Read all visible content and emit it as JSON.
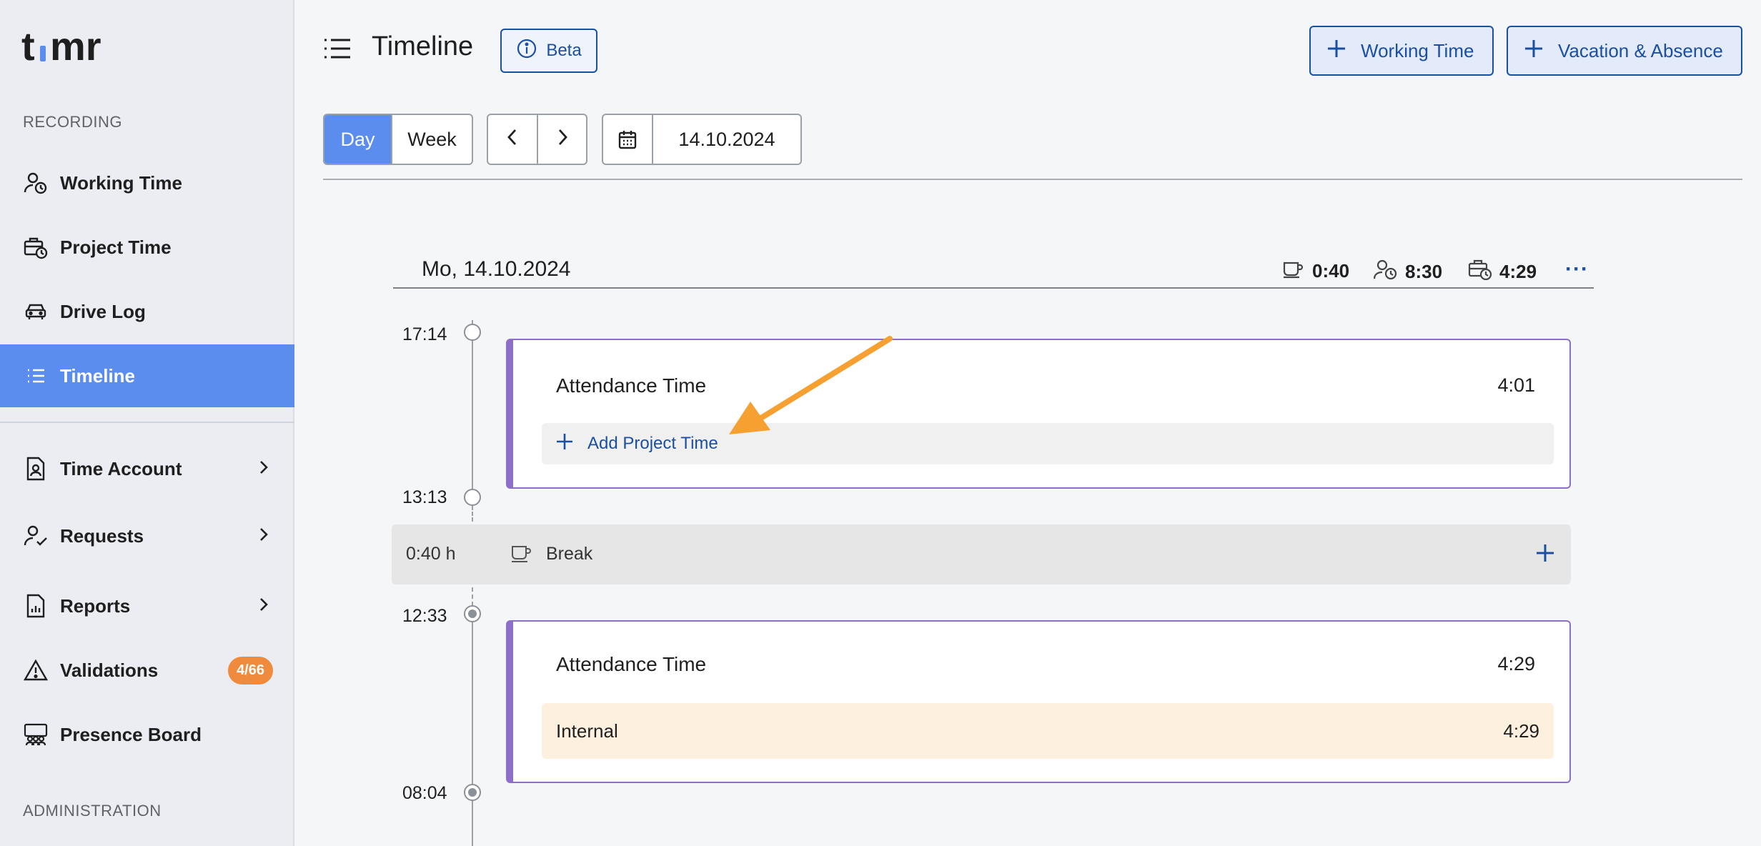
{
  "app": {
    "logo_text": "timr"
  },
  "sidebar": {
    "recording_label": "RECORDING",
    "administration_label": "ADMINISTRATION",
    "items": [
      {
        "label": "Working Time",
        "icon": "user-clock-icon"
      },
      {
        "label": "Project Time",
        "icon": "briefcase-clock-icon"
      },
      {
        "label": "Drive Log",
        "icon": "car-icon"
      },
      {
        "label": "Timeline",
        "icon": "list-icon",
        "active": true
      },
      {
        "label": "Time Account",
        "icon": "document-person-icon"
      },
      {
        "label": "Requests",
        "icon": "user-check-icon"
      },
      {
        "label": "Reports",
        "icon": "report-icon"
      },
      {
        "label": "Validations",
        "icon": "warning-icon",
        "badge": "4/66"
      },
      {
        "label": "Presence Board",
        "icon": "presence-board-icon"
      }
    ]
  },
  "header": {
    "title": "Timeline",
    "beta_label": "Beta",
    "working_time_button": "Working Time",
    "vacation_button": "Vacation & Absence"
  },
  "controls": {
    "day_label": "Day",
    "week_label": "Week",
    "date_value": "14.10.2024"
  },
  "day": {
    "title": "Mo, 14.10.2024",
    "break_total": "0:40",
    "working_total": "8:30",
    "project_total": "4:29"
  },
  "timeline": {
    "times": [
      "17:14",
      "13:13",
      "12:33",
      "08:04"
    ],
    "card1": {
      "title": "Attendance Time",
      "duration": "4:01",
      "add_label": "Add Project Time"
    },
    "break": {
      "duration": "0:40 h",
      "label": "Break"
    },
    "card2": {
      "title": "Attendance Time",
      "duration": "4:29",
      "project_name": "Internal",
      "project_duration": "4:29"
    }
  },
  "colors": {
    "accent": "#5b8def",
    "primary_blue": "#1a4fa3",
    "card_border": "#8d6fc9",
    "badge": "#f08a3c",
    "arrow": "#f5a030",
    "project_bg": "#fdf0df"
  }
}
